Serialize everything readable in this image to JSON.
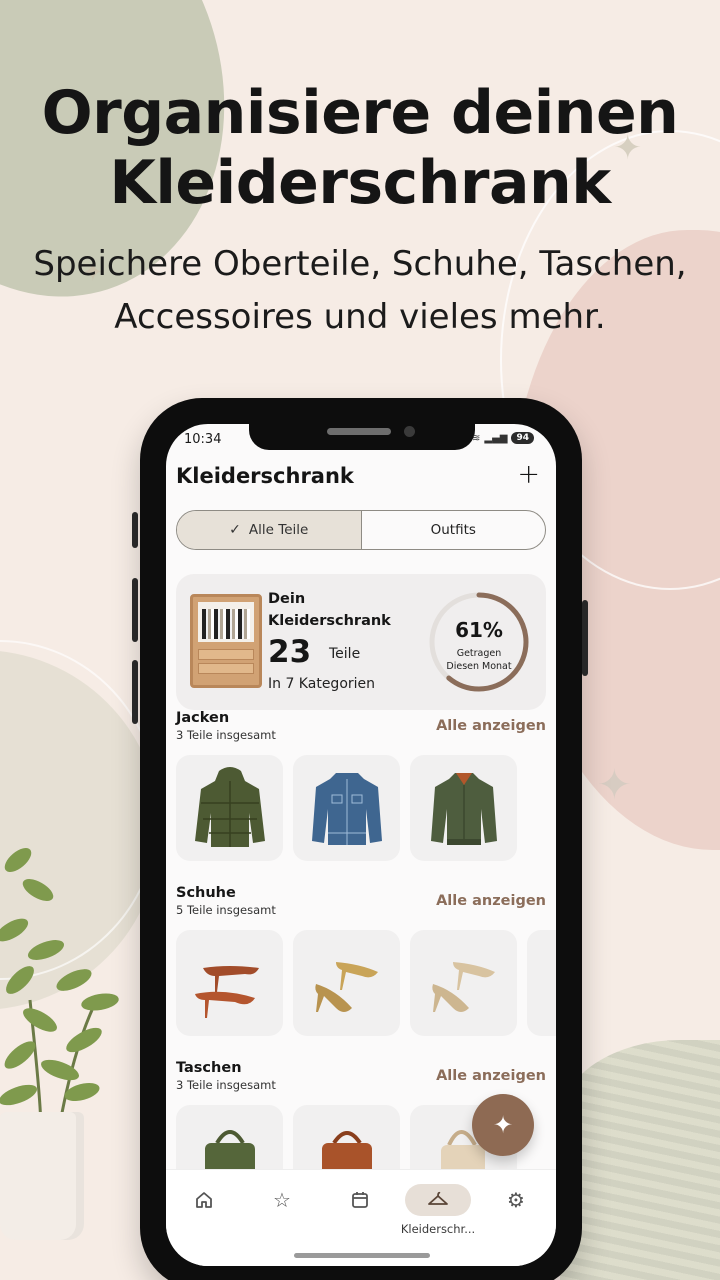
{
  "promo": {
    "headline_line1": "Organisiere deinen",
    "headline_line2": "Kleiderschrank",
    "subheadline": "Speichere Oberteile, Schuhe, Taschen, Accessoires und vieles mehr."
  },
  "status_bar": {
    "time": "10:34",
    "battery": "94"
  },
  "header": {
    "title": "Kleiderschrank",
    "add_icon": "plus-icon"
  },
  "segmented": {
    "options": [
      "Alle Teile",
      "Outfits"
    ],
    "selected": "Alle Teile"
  },
  "summary": {
    "label": "Dein Kleiderschrank",
    "count": "23",
    "unit": "Teile",
    "categories_text": "In 7 Kategorien",
    "worn_percent": 61,
    "worn_percent_text": "61%",
    "worn_label_line1": "Getragen",
    "worn_label_line2": "Diesen Monat"
  },
  "sections": [
    {
      "title": "Jacken",
      "subtitle": "3 Teile insgesamt",
      "link": "Alle anzeigen",
      "items": [
        "puffer-jacket",
        "denim-jacket",
        "bomber-jacket"
      ]
    },
    {
      "title": "Schuhe",
      "subtitle": "5 Teile insgesamt",
      "link": "Alle anzeigen",
      "items": [
        "brown-pumps",
        "gold-glitter-pumps",
        "champagne-glitter-pumps"
      ]
    },
    {
      "title": "Taschen",
      "subtitle": "3 Teile insgesamt",
      "link": "Alle anzeigen",
      "items": [
        "green-handbag",
        "brown-leather-bag",
        "beige-bag"
      ]
    }
  ],
  "bottom_nav": {
    "items": [
      {
        "icon": "home-icon",
        "label": ""
      },
      {
        "icon": "star-icon",
        "label": ""
      },
      {
        "icon": "calendar-icon",
        "label": ""
      },
      {
        "icon": "hanger-icon",
        "label": "Kleiderschr..."
      },
      {
        "icon": "gear-icon",
        "label": ""
      }
    ],
    "active": "Kleiderschr..."
  },
  "colors": {
    "accent_brown": "#8b6d5a",
    "segment_active": "#e7e1d8",
    "gauge_track": "#e3dfdc"
  }
}
